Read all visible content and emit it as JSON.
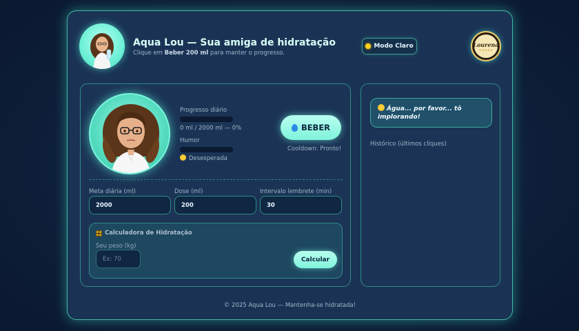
{
  "header": {
    "title": "Aqua Lou — Sua amiga de hidratação",
    "subtitle_prefix": "Clique em ",
    "subtitle_bold": "Beber 200 ml",
    "subtitle_suffix": " para manter o progresso.",
    "mode_button": "Modo Claro",
    "logo_text": "Lourena",
    "logo_stars": "★★★★★"
  },
  "status": {
    "progress_label": "Progresso diário",
    "progress_text": "0 ml / 2000 ml — 0%",
    "progress_fraction": 0,
    "mood_label": "Humor",
    "mood_text": "Desesperada",
    "mood_fraction": 0
  },
  "actions": {
    "drink_button": "BEBER",
    "cooldown": "Cooldown: Pronto!"
  },
  "settings": {
    "goal_label": "Meta diária (ml)",
    "goal_value": "2000",
    "dose_label": "Dose (ml)",
    "dose_value": "200",
    "interval_label": "Intervalo lembrete (min)",
    "interval_value": "30"
  },
  "calculator": {
    "title": "Calculadora de Hidratação",
    "weight_label": "Seu peso (kg)",
    "weight_placeholder": "Ex: 70",
    "button": "Calcular"
  },
  "sidebar": {
    "message": "Água... por favor... tô implorando!",
    "history_label": "Histórico (últimos cliques)"
  },
  "footer": "© 2025 Aqua Lou — Mantenha-se hidratada!",
  "colors": {
    "accent": "#7ff3da",
    "panel": "#1b3456",
    "border": "#2f8c86"
  }
}
